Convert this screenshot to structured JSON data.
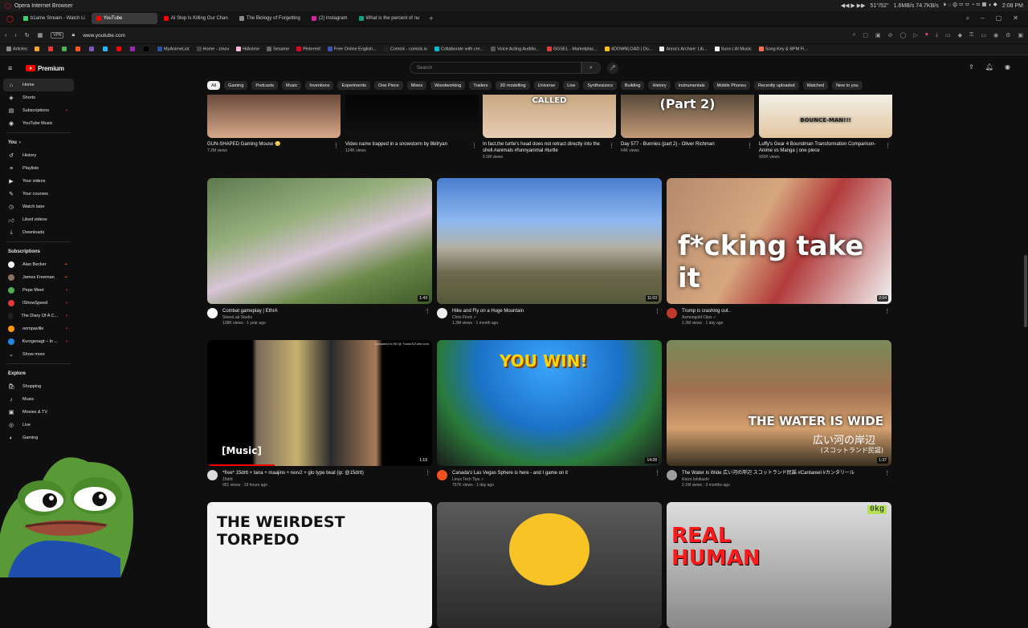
{
  "os": {
    "browser_title": "Opera Internet Browser",
    "time": "2:08 PM",
    "net_up": "1.6MB/s",
    "net_down": "74.7KB/s",
    "temp_a": "51°",
    "temp_b": "52°"
  },
  "tabs": [
    {
      "label": "b1ame Stream - Watch Li",
      "color": "#3bd16f"
    },
    {
      "label": "YouTube",
      "color": "#ff0000"
    },
    {
      "label": "AI Slop Is Killing Our Chan",
      "color": "#ff0000"
    },
    {
      "label": "The Biology of Forgetting",
      "color": "#8a8a8a"
    },
    {
      "label": "(2) Instagram",
      "color": "#d6249f"
    },
    {
      "label": "What is the percent of nu",
      "color": "#10a37f"
    }
  ],
  "url": "www.youtube.com",
  "vpn_label": "VPN",
  "bookmarks": [
    {
      "label": "Articles",
      "color": "#888"
    },
    {
      "label": "",
      "color": "#f5a623"
    },
    {
      "label": "",
      "color": "#e53935"
    },
    {
      "label": "",
      "color": "#4caf50"
    },
    {
      "label": "",
      "color": "#ff5722"
    },
    {
      "label": "",
      "color": "#7e57c2"
    },
    {
      "label": "",
      "color": "#29b6f6"
    },
    {
      "label": "",
      "color": "#ff0000"
    },
    {
      "label": "",
      "color": "#9c27b0"
    },
    {
      "label": "",
      "color": "#000000"
    },
    {
      "label": "MyAnimeList",
      "color": "#2e51a2"
    },
    {
      "label": "Home - zmov",
      "color": "#444"
    },
    {
      "label": "HiAnime",
      "color": "#ffbade"
    },
    {
      "label": "Sesame",
      "color": "#666"
    },
    {
      "label": "Pinterest",
      "color": "#e60023"
    },
    {
      "label": "Free Online English...",
      "color": "#3f51b5"
    },
    {
      "label": "Comick - comick.io",
      "color": "#222"
    },
    {
      "label": "Collaborate with cre...",
      "color": "#00bcd4"
    },
    {
      "label": "Voice Acting Auditio...",
      "color": "#555"
    },
    {
      "label": "GGSEL - Marketplac...",
      "color": "#e53935"
    },
    {
      "label": "4DOWNLOAD | Do...",
      "color": "#ffc107"
    },
    {
      "label": "Anna's Archive: Lib...",
      "color": "#eee"
    },
    {
      "label": "Suno | AI Music",
      "color": "#fff"
    },
    {
      "label": "Song Key & BPM Fi...",
      "color": "#ff7043"
    }
  ],
  "header": {
    "logo_text": "Premium",
    "search_placeholder": "Search"
  },
  "sidebar": {
    "main": [
      {
        "label": "Home",
        "icon": "home-icon",
        "glyph": "⌂",
        "active": true
      },
      {
        "label": "Shorts",
        "icon": "shorts-icon",
        "glyph": "◈"
      },
      {
        "label": "Subscriptions",
        "icon": "subscriptions-icon",
        "glyph": "▤",
        "dot": "•"
      },
      {
        "label": "YouTube Music",
        "icon": "music-icon",
        "glyph": "◉"
      }
    ],
    "you_heading": "You",
    "you": [
      {
        "label": "History",
        "icon": "history-icon",
        "glyph": "↺"
      },
      {
        "label": "Playlists",
        "icon": "playlists-icon",
        "glyph": "≡"
      },
      {
        "label": "Your videos",
        "icon": "your-videos-icon",
        "glyph": "▶"
      },
      {
        "label": "Your courses",
        "icon": "courses-icon",
        "glyph": "✎"
      },
      {
        "label": "Watch later",
        "icon": "watch-later-icon",
        "glyph": "◷"
      },
      {
        "label": "Liked videos",
        "icon": "like-icon",
        "glyph": "👍︎"
      },
      {
        "label": "Downloads",
        "icon": "download-icon",
        "glyph": "⤓"
      }
    ],
    "subs_heading": "Subscriptions",
    "subs": [
      {
        "label": "Alan Becker",
        "color": "#f5f5f5",
        "dot": "••"
      },
      {
        "label": "James Freeman",
        "color": "#8d6e63",
        "dot": "••"
      },
      {
        "label": "Pepe Meet",
        "color": "#4caf50",
        "dot": "•"
      },
      {
        "label": "IShowSpeed",
        "color": "#e53935",
        "dot": "•"
      },
      {
        "label": "The Diary Of A C...",
        "color": "#222",
        "dot": "•"
      },
      {
        "label": "oompaville",
        "color": "#ff9800",
        "dot": "•"
      },
      {
        "label": "Kurzgesagt – In ...",
        "color": "#1e88e5",
        "dot": "•"
      }
    ],
    "show_more": "Show more",
    "explore_heading": "Explore",
    "explore": [
      {
        "label": "Shopping",
        "icon": "shopping-icon",
        "glyph": "🛍︎"
      },
      {
        "label": "Music",
        "icon": "music-note-icon",
        "glyph": "♪"
      },
      {
        "label": "Movies & TV",
        "icon": "movies-icon",
        "glyph": "▣"
      },
      {
        "label": "Live",
        "icon": "live-icon",
        "glyph": "◎"
      },
      {
        "label": "Gaming",
        "icon": "gaming-icon",
        "glyph": "◐"
      }
    ]
  },
  "chips": [
    "All",
    "Gaming",
    "Podcasts",
    "Music",
    "Inventions",
    "Experiments",
    "One Piece",
    "Mixes",
    "Woodworking",
    "Trailers",
    "3D modelling",
    "Universe",
    "Live",
    "Synthesizers",
    "Building",
    "History",
    "Instrumentals",
    "Mobile Phones",
    "Recently uploaded",
    "Watched",
    "New to you"
  ],
  "shorts": [
    {
      "title": "GUN-SHAPED Gaming Mouse 😳",
      "views": "7.2M views",
      "thumb_text": ""
    },
    {
      "title": "Video name trapped in a snowstorm by 8bitryan",
      "views": "124K views",
      "thumb_text": ""
    },
    {
      "title": "In fact,the turtle's head does not retract directly into the shell.#animals #funnyanimal #turtle",
      "views": "5.5M views",
      "thumb_text": "CALLED"
    },
    {
      "title": "Day 577 - Bunnies (part 2) - Oliver Richman",
      "views": "64K views",
      "thumb_text": "(Part 2)"
    },
    {
      "title": "Luffy's Gear 4 Boundman Transformation Comparison- Anime vs Manga | one piece",
      "views": "920K views",
      "thumb_text": "BOUNCE-MAN!!!"
    }
  ],
  "videos": [
    {
      "title": "Combat gameplay | EthrA",
      "channel": "StoneLab Studio",
      "stats": "138K views · 1 year ago",
      "duration": "1:43",
      "avatar": "#ffffff"
    },
    {
      "title": "Hike and Fly on a Huge Mountain",
      "channel": "Chris Finck ✓",
      "stats": "1.3M views · 1 month ago",
      "duration": "11:03",
      "avatar": "#eeeeee"
    },
    {
      "title": "Trump is crashing out..",
      "channel": "Asmongold Clips ✓",
      "stats": "1.3M views · 1 day ago",
      "duration": "2:04",
      "avatar": "#c0392b",
      "overlay": "f*cking take it"
    },
    {
      "title": "*free* 15drtt + tana + maajins + rexv2 + glo type beat (ip: @15drtt)",
      "channel": "15drtt",
      "stats": "951 views · 19 hours ago",
      "duration": "1:19",
      "avatar": "#dddddd",
      "overlay": "[Music]",
      "corner": "uploaded in HD @ TunesToTube.com"
    },
    {
      "title": "Canada's Las Vegas Sphere is here - and I game on it",
      "channel": "Linus Tech Tips ✓",
      "stats": "757K views · 1 day ago",
      "duration": "14:28",
      "avatar": "#f4511e",
      "overlay": "YOU WIN!"
    },
    {
      "title": "The Water Is Wide 広い河の岸辺 スコットランド民謡 #Cantareel #カンタリール",
      "channel": "Keizo Ishibashi",
      "stats": "2.1M views · 3 months ago",
      "duration": "1:37",
      "avatar": "#9e9e9e",
      "overlay": "THE WATER IS WIDE",
      "overlay2": "広い河の岸辺",
      "overlay3": "(スコットランド民謡)"
    }
  ],
  "bottom_row": [
    {
      "overlay": "THE WEIRDEST TORPEDO"
    },
    {
      "overlay": ""
    },
    {
      "overlay": "REAL HUMAN",
      "scale": "0kg"
    }
  ]
}
